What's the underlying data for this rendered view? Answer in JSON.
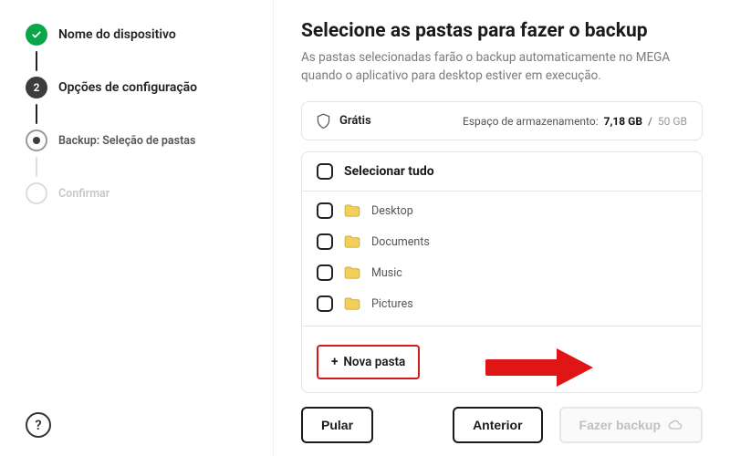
{
  "sidebar": {
    "steps": {
      "device": {
        "label": "Nome do dispositivo"
      },
      "options": {
        "num": "2",
        "label": "Opções de configuração"
      },
      "backup": {
        "label": "Backup: Seleção de pastas"
      },
      "confirm": {
        "label": "Confirmar"
      }
    },
    "help": "?"
  },
  "main": {
    "title": "Selecione as pastas para fazer o backup",
    "subtitle": "As pastas selecionadas farão o backup automaticamente no MEGA quando o aplicativo para desktop estiver em execução."
  },
  "plan": {
    "name": "Grátis",
    "storage_label": "Espaço de armazenamento:",
    "used": "7,18 GB",
    "sep": "/",
    "total": "50 GB"
  },
  "folders": {
    "select_all": "Selecionar tudo",
    "items": [
      {
        "name": "Desktop"
      },
      {
        "name": "Documents"
      },
      {
        "name": "Music"
      },
      {
        "name": "Pictures"
      }
    ],
    "new_folder": "Nova pasta"
  },
  "footer": {
    "skip": "Pular",
    "prev": "Anterior",
    "backup": "Fazer backup"
  }
}
